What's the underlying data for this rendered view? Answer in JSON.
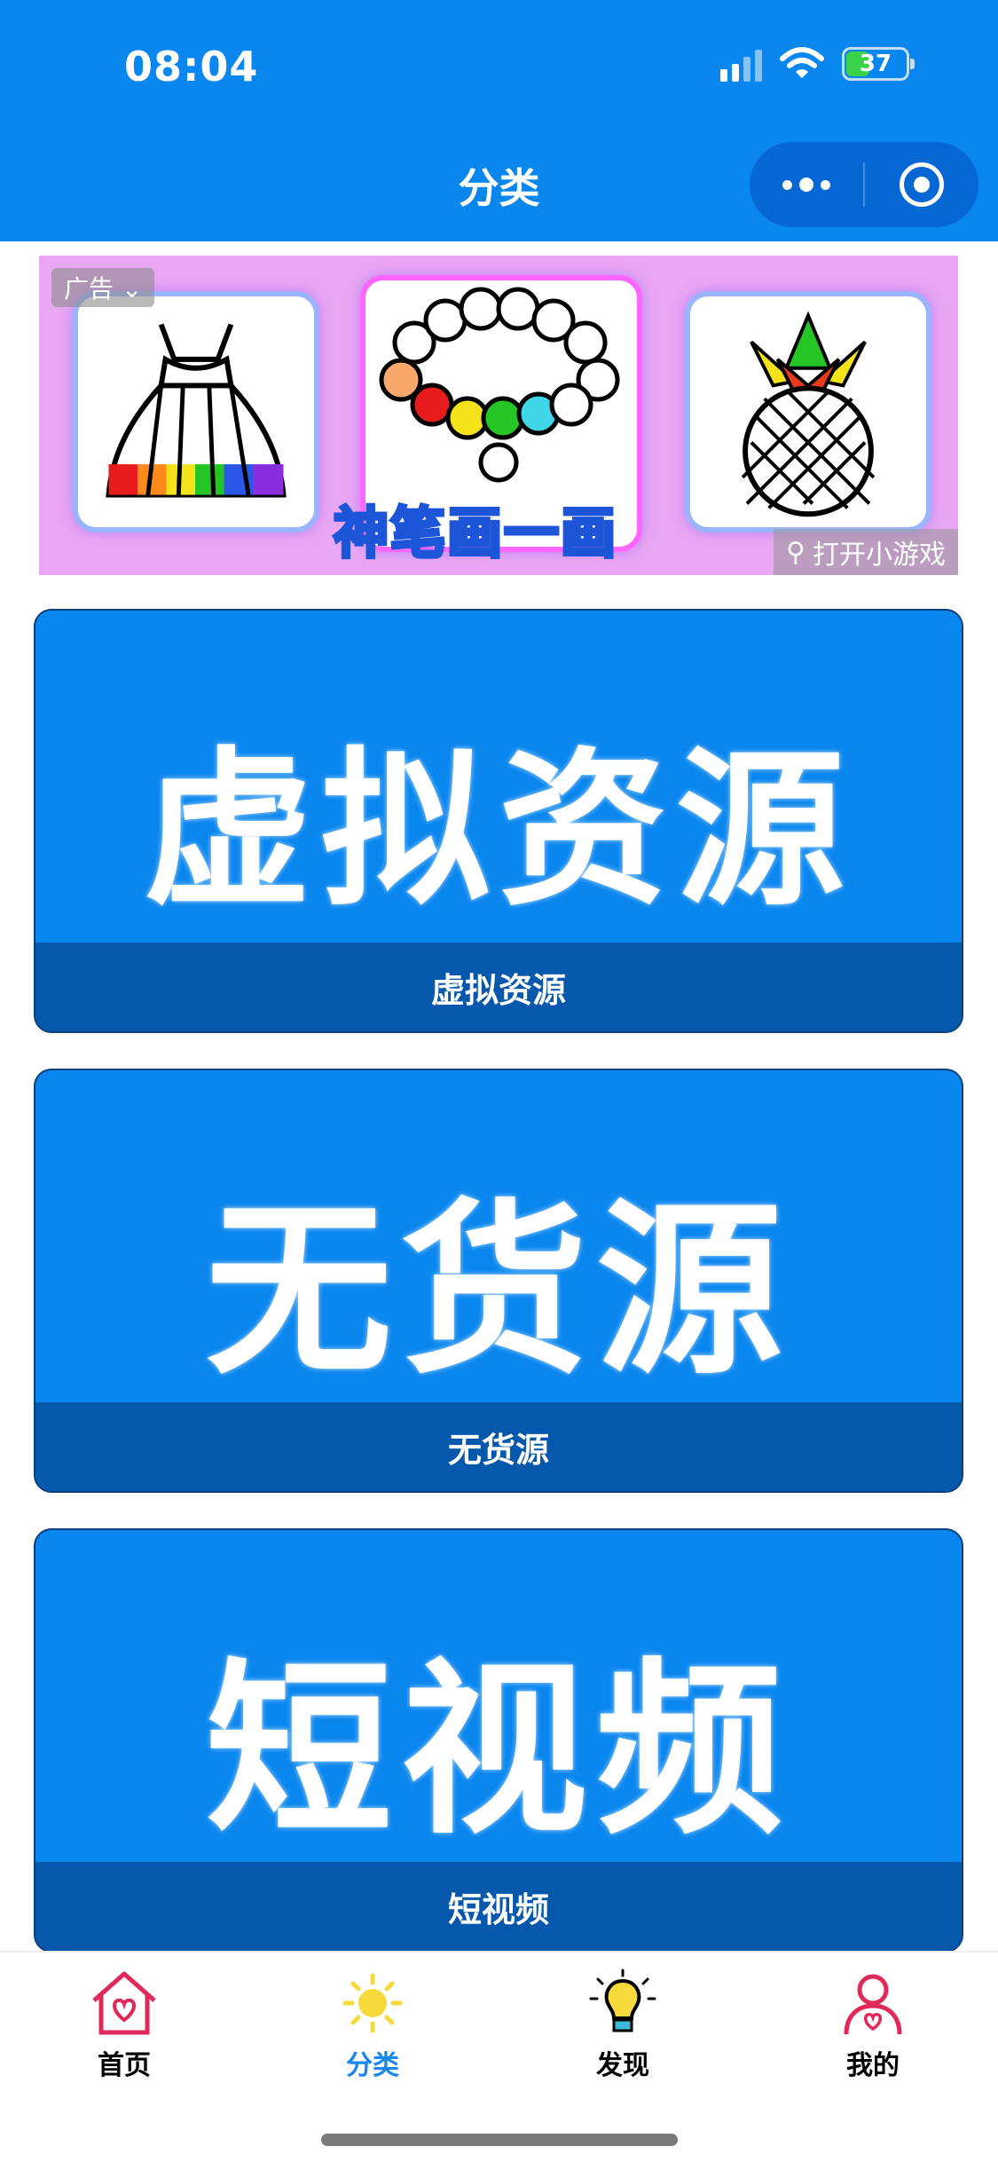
{
  "status_bar": {
    "time": "08:04",
    "battery": "37"
  },
  "header": {
    "title": "分类"
  },
  "ad": {
    "tag": "广告",
    "logo_text": "神笔画一画",
    "open_label": "打开小游戏"
  },
  "categories": [
    {
      "big_text": "虚拟资源",
      "label": "虚拟资源"
    },
    {
      "big_text": "无货源",
      "label": "无货源"
    },
    {
      "big_text": "短视频",
      "label": "短视频"
    }
  ],
  "tabbar": {
    "tabs": [
      {
        "label": "首页",
        "icon": "home-heart-icon"
      },
      {
        "label": "分类",
        "icon": "sun-icon",
        "active": true
      },
      {
        "label": "发现",
        "icon": "lightbulb-icon"
      },
      {
        "label": "我的",
        "icon": "user-heart-icon"
      }
    ]
  },
  "colors": {
    "header_bg": "#0a86ef",
    "card_bg": "#0a86ef",
    "card_label_bg": "#0558ab",
    "active_tab": "#1a87ee"
  }
}
